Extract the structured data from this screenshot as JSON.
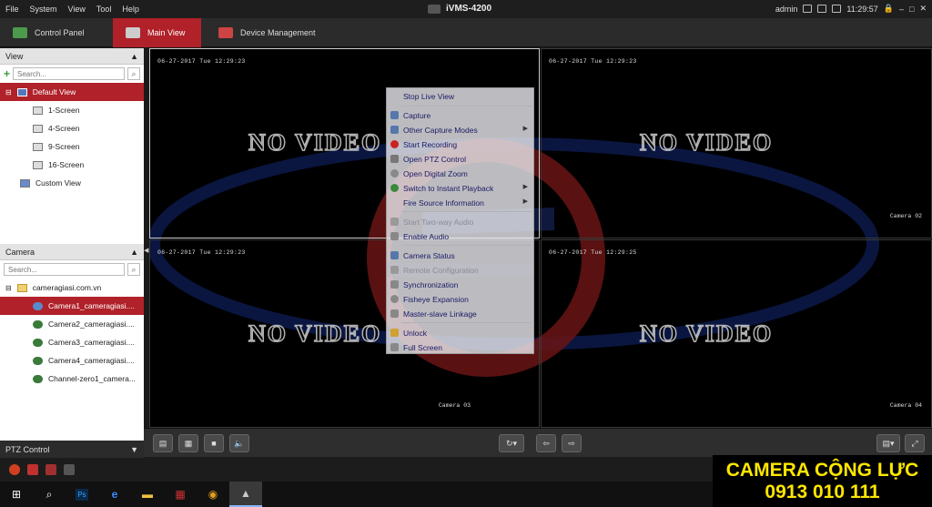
{
  "menubar": {
    "items": [
      "File",
      "System",
      "View",
      "Tool",
      "Help"
    ]
  },
  "app": {
    "title": "iVMS-4200"
  },
  "status": {
    "user": "admin",
    "time": "11:29:57"
  },
  "tabs": [
    {
      "label": "Control Panel"
    },
    {
      "label": "Main View"
    },
    {
      "label": "Device Management"
    }
  ],
  "view_panel": {
    "title": "View",
    "search_placeholder": "Search...",
    "items": [
      "Default View",
      "1-Screen",
      "4-Screen",
      "9-Screen",
      "16-Screen",
      "Custom View"
    ]
  },
  "camera_panel": {
    "title": "Camera",
    "search_placeholder": "Search...",
    "root": "cameragiasi.com.vn",
    "cameras": [
      "Camera1_cameragiasi....",
      "Camera2_cameragiasi....",
      "Camera3_cameragiasi....",
      "Camera4_cameragiasi....",
      "Channel-zero1_camera..."
    ]
  },
  "ptz_panel": {
    "title": "PTZ Control"
  },
  "tiles": [
    {
      "timestamp": "06-27-2017 Tue 12:29:23",
      "no_video": "NO VIDEO",
      "camera": ""
    },
    {
      "timestamp": "06-27-2017 Tue 12:29:23",
      "no_video": "NO VIDEO",
      "camera": "Camera 02"
    },
    {
      "timestamp": "06-27-2017 Tue 12:29:23",
      "no_video": "NO VIDEO",
      "camera": "Camera 03"
    },
    {
      "timestamp": "06-27-2017 Tue 12:29:25",
      "no_video": "NO VIDEO",
      "camera": "Camera 04"
    }
  ],
  "context_menu": {
    "items": [
      "Stop Live View",
      "Capture",
      "Other Capture Modes",
      "Start Recording",
      "Open PTZ Control",
      "Open Digital Zoom",
      "Switch to Instant Playback",
      "Fire Source Information",
      "Start Two-way Audio",
      "Enable Audio",
      "Camera Status",
      "Remote Configuration",
      "Synchronization",
      "Fisheye Expansion",
      "Master-slave Linkage",
      "Unlock",
      "Full Screen"
    ]
  },
  "watermark": {
    "line1": "CAMERA CỘNG LỰC",
    "line2": "0913 010 111"
  }
}
